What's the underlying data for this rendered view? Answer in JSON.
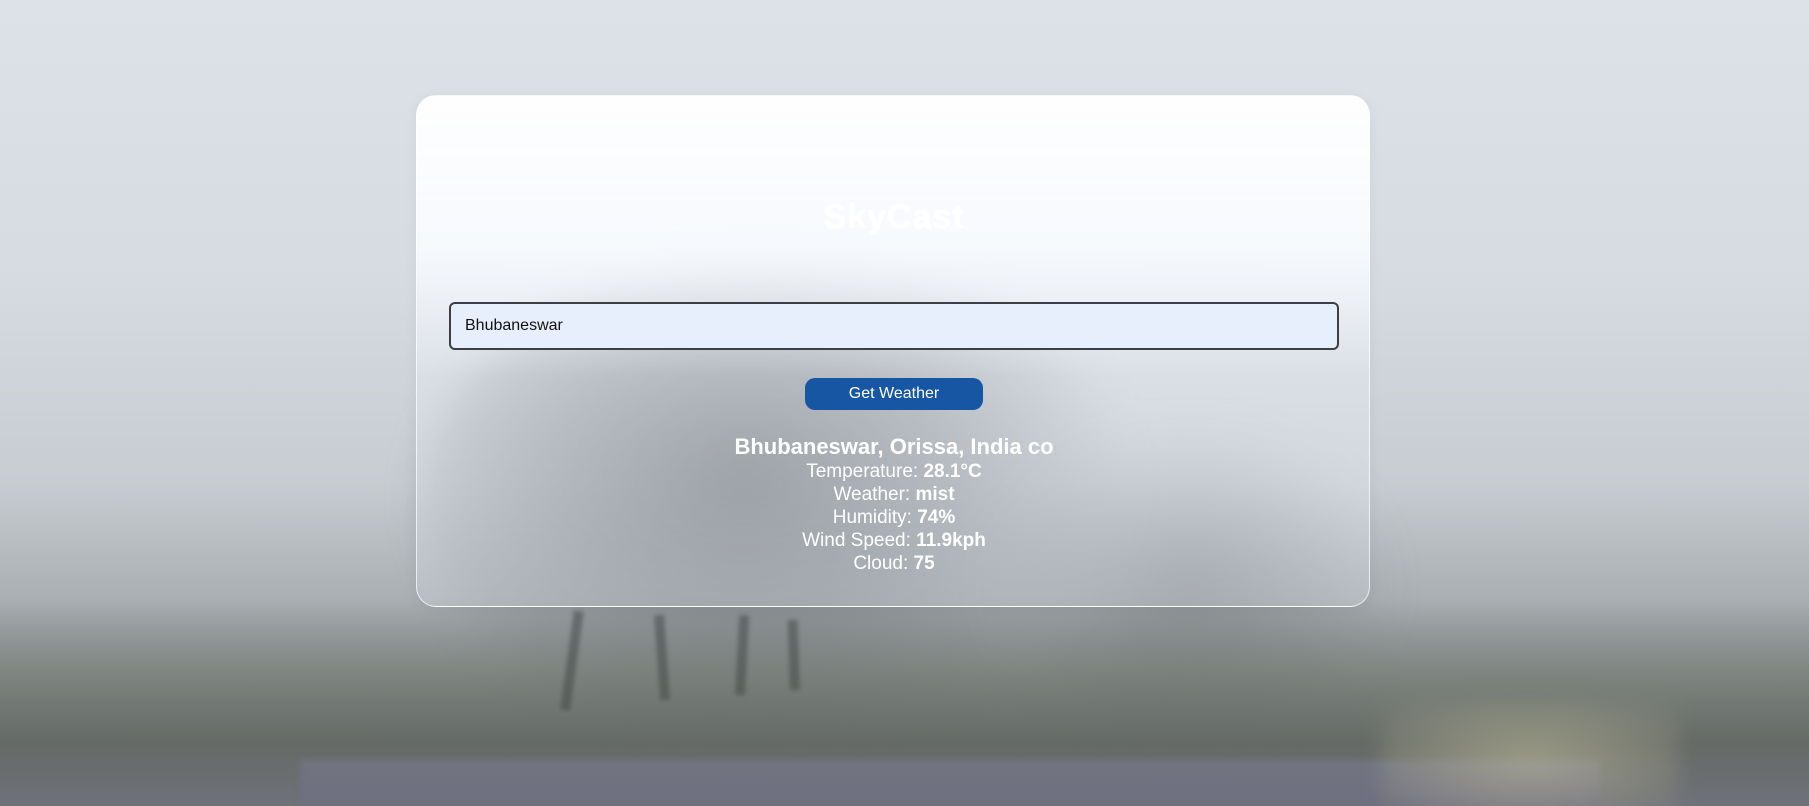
{
  "app": {
    "title": "SkyCast"
  },
  "search": {
    "value": "Bhubaneswar"
  },
  "actions": {
    "get_weather_label": "Get Weather"
  },
  "result": {
    "location": "Bhubaneswar, Orissa, India co",
    "temperature_label": "Temperature: ",
    "temperature_value": "28.1°C",
    "weather_label": "Weather: ",
    "weather_value": "mist",
    "humidity_label": "Humidity: ",
    "humidity_value": "74%",
    "wind_label": "Wind Speed: ",
    "wind_value": "11.9kph",
    "cloud_label": "Cloud: ",
    "cloud_value": "75"
  },
  "colors": {
    "button": "#1656a3",
    "input_bg": "#e8effc",
    "text_on_bg": "#ffffff"
  }
}
